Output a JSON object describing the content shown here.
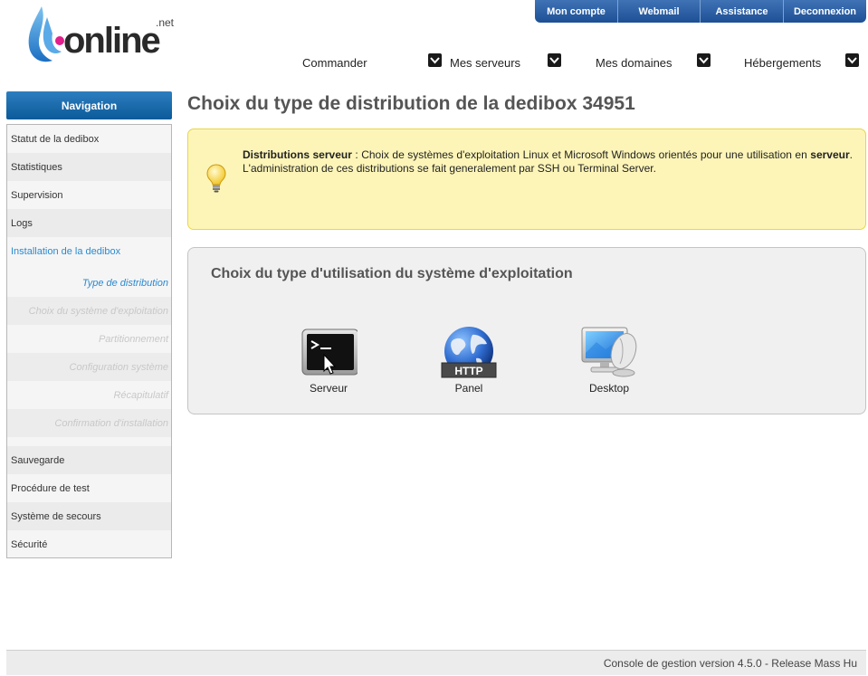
{
  "brand": {
    "logo_text": "online",
    "logo_suffix": ".net"
  },
  "account_menu": [
    {
      "label": "Mon compte"
    },
    {
      "label": "Webmail"
    },
    {
      "label": "Assistance"
    },
    {
      "label": "Deconnexion"
    }
  ],
  "main_menu": [
    {
      "label": "Commander"
    },
    {
      "label": "Mes serveurs"
    },
    {
      "label": "Mes domaines"
    },
    {
      "label": "Hébergements"
    }
  ],
  "sidebar": {
    "header": "Navigation",
    "items_top": [
      {
        "label": "Statut de la dedibox"
      },
      {
        "label": "Statistiques"
      },
      {
        "label": "Supervision"
      },
      {
        "label": "Logs"
      },
      {
        "label": "Installation de la dedibox"
      }
    ],
    "sub_items": [
      {
        "label": "Type de distribution"
      },
      {
        "label": "Choix du système d'exploitation"
      },
      {
        "label": "Partitionnement"
      },
      {
        "label": "Configuration système"
      },
      {
        "label": "Récapitulatif"
      },
      {
        "label": "Confirmation d'installation"
      }
    ],
    "items_bottom": [
      {
        "label": "Sauvegarde"
      },
      {
        "label": "Procédure de test"
      },
      {
        "label": "Système de secours"
      },
      {
        "label": "Sécurité"
      }
    ]
  },
  "page": {
    "title": "Choix du type de distribution de la dedibox 34951"
  },
  "info": {
    "strong_label": "Distributions serveur",
    "text_part1": " : Choix de systèmes d'exploitation Linux et Microsoft Windows orientés pour une utilisation en ",
    "strong_word": "serveur",
    "text_part2": ". L'administration de ces distributions se fait generalement par SSH ou Terminal Server."
  },
  "choices": {
    "title": "Choix du type d'utilisation du système d'exploitation",
    "items": [
      {
        "label": "Serveur",
        "icon": "terminal-icon"
      },
      {
        "label": "Panel",
        "icon": "http-globe-icon",
        "badge": "HTTP"
      },
      {
        "label": "Desktop",
        "icon": "desktop-monitor-icon"
      }
    ]
  },
  "footer": {
    "text": "Console de gestion version 4.5.0 - Release Mass Hu"
  },
  "colors": {
    "brand_blue": "#1d4f95",
    "nav_blue": "#0b5a99",
    "link_active": "#2a8ad0",
    "info_bg": "#fdf5b8",
    "info_border": "#e8d64a"
  }
}
